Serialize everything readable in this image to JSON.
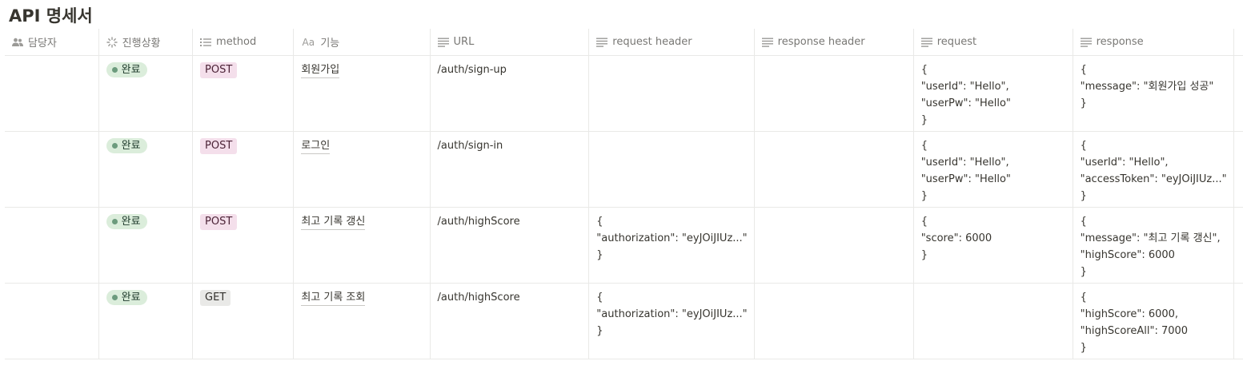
{
  "page": {
    "title": "API 명세서"
  },
  "columns": [
    {
      "label": "담당자",
      "icon": "people-icon"
    },
    {
      "label": "진행상황",
      "icon": "status-spinner-icon"
    },
    {
      "label": "method",
      "icon": "list-icon"
    },
    {
      "label": "기능",
      "icon": "title-aa-icon",
      "icon_text": "Aa"
    },
    {
      "label": "URL",
      "icon": "text-lines-icon"
    },
    {
      "label": "request header",
      "icon": "text-lines-icon"
    },
    {
      "label": "response header",
      "icon": "text-lines-icon"
    },
    {
      "label": "request",
      "icon": "text-lines-icon"
    },
    {
      "label": "response",
      "icon": "text-lines-icon"
    }
  ],
  "rows": [
    {
      "assignee": "",
      "status": "완료",
      "method": "POST",
      "feature": "회원가입",
      "url": "/auth/sign-up",
      "request_header": [],
      "response_header": [],
      "request": [
        "{",
        "\"userId\": \"Hello\",",
        "\"userPw\": \"Hello\"",
        "}"
      ],
      "response": [
        "{",
        "\"message\": \"회원가입 성공\"",
        "}"
      ]
    },
    {
      "assignee": "",
      "status": "완료",
      "method": "POST",
      "feature": "로그인",
      "url": "/auth/sign-in",
      "request_header": [],
      "response_header": [],
      "request": [
        "{",
        "\"userId\": \"Hello\",",
        "\"userPw\": \"Hello\"",
        "}"
      ],
      "response": [
        "{",
        "\"userId\": \"Hello\",",
        "\"accessToken\": \"eyJOiJIUz...\"",
        "}"
      ]
    },
    {
      "assignee": "",
      "status": "완료",
      "method": "POST",
      "feature": "최고 기록 갱신",
      "url": "/auth/highScore",
      "request_header": [
        "{",
        "\"authorization\": \"eyJOiJIUz...\"",
        "}"
      ],
      "response_header": [],
      "request": [
        "{",
        "\"score\": 6000",
        "}"
      ],
      "response": [
        "{",
        "\"message\": \"최고 기록 갱신\",",
        "\"highScore\": 6000",
        "}"
      ]
    },
    {
      "assignee": "",
      "status": "완료",
      "method": "GET",
      "feature": "최고 기록 조회",
      "url": "/auth/highScore",
      "request_header": [
        "{",
        "\"authorization\": \"eyJOiJIUz...\"",
        "}"
      ],
      "response_header": [],
      "request": [],
      "response": [
        "{",
        "\"highScore\": 6000,",
        "\"highScoreAll\": 7000",
        "}"
      ]
    }
  ],
  "colors": {
    "status_done_bg": "#dbeddb",
    "status_done_dot": "#6c9b7d",
    "method_post_bg": "#f4dfeb",
    "method_get_bg": "#e9e9e7",
    "border": "#e9e9e7",
    "header_text": "#787774"
  }
}
